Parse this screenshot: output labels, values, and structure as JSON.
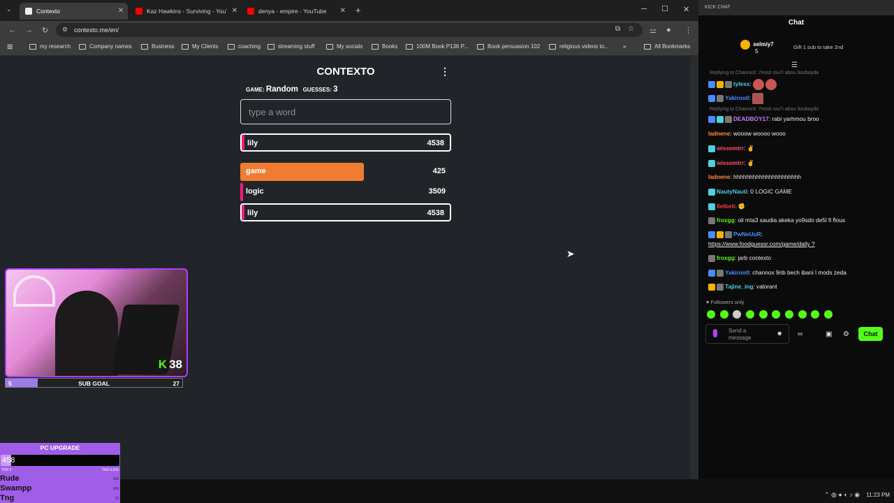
{
  "browser": {
    "tabs": [
      {
        "title": "Contexto",
        "color": "#3c3c3c"
      },
      {
        "title": "Kaz Hawkins - Surviving - YouTube",
        "color": "#ff0000"
      },
      {
        "title": "denya - empire - YouTube",
        "color": "#ff0000"
      }
    ],
    "url": "contexto.me/en/",
    "bookmarks": [
      "my research",
      "Company names",
      "Business",
      "My Clients",
      "coaching",
      "streaming stuff",
      "My socials",
      "Books",
      "100M Book P136 P...",
      "Book persuasion 102",
      "religious videos to...",
      "All Bookmarks"
    ]
  },
  "game": {
    "title": "CONTEXTO",
    "game_label": "GAME:",
    "game_value": "Random",
    "guesses_label": "GUESSES:",
    "guesses_value": "3",
    "input_placeholder": "type a word",
    "last_guess": {
      "word": "lily",
      "rank": "4538"
    },
    "guesses": [
      {
        "word": "game",
        "rank": "425",
        "bar_fraction": 0.59,
        "color": "#ef7d31"
      },
      {
        "word": "logic",
        "rank": "3509",
        "bar_fraction": 0.012,
        "color": "#f01d7a"
      },
      {
        "word": "lily",
        "rank": "4538",
        "bar_fraction": 0.01,
        "color": "#f01d7a"
      }
    ]
  },
  "overlay": {
    "kick_count": "38",
    "subgoal": {
      "current": "5",
      "label": "SUB GOAL",
      "target": "27",
      "progress": 0.18
    },
    "pc_upgrade": {
      "title": "PC UPGRADE",
      "value": "458",
      "min": "TND 0",
      "max": "TND 5,000",
      "progress": 0.09,
      "donors": [
        {
          "name": "Rude",
          "amount": "120"
        },
        {
          "name": "Swampp",
          "amount": "100"
        },
        {
          "name": "Tng",
          "amount": "70"
        }
      ]
    }
  },
  "chat": {
    "header": "KICK CHAT",
    "title": "Chat",
    "top_gifter": {
      "name": "selmiy7",
      "count": "5"
    },
    "gift_prompt": "Gift 1 sub to take 2nd",
    "messages": [
      {
        "type": "reply",
        "text": "Replying to ChannoX: 7essit rou7i abou 3oubayda"
      },
      {
        "user": "tylexx",
        "color": "#4dd0e1",
        "text": ""
      },
      {
        "user": "Yakiroo0",
        "color": "#4a8cff",
        "text": ""
      },
      {
        "type": "reply",
        "text": "Replying to ChannoX: 7essit rou7i abou 3oubayda"
      },
      {
        "user": "DEADBOY17",
        "color": "#c77dff",
        "text": "rabi yarhmou broo"
      },
      {
        "user": "ladnene",
        "color": "#ff8a3d",
        "text": "wooow woooo wooo"
      },
      {
        "user": "wissemtrr",
        "color": "#ff4d6d",
        "text": ""
      },
      {
        "user": "wissemtrr",
        "color": "#ff4d6d",
        "text": ""
      },
      {
        "user": "ladnene",
        "color": "#ff8a3d",
        "text": "hhhhhhhhhhhhhhhhhhhhh"
      },
      {
        "user": "NautyNauti",
        "color": "#4dd0e1",
        "text": "0 LOGIC GAME"
      },
      {
        "user": "lletbeli",
        "color": "#ff3b3b",
        "text": ""
      },
      {
        "user": "froxgg",
        "color": "#53fc18",
        "text": "oil mta3 saudia akeka yo9sdo de5l fi flous"
      },
      {
        "user": "PwNeUuR",
        "color": "#4a8cff",
        "text": ""
      },
      {
        "type": "link",
        "text": "https://www.foodguessr.com/game/daily ?"
      },
      {
        "user": "froxgg",
        "color": "#53fc18",
        "text": "jarb contexto"
      },
      {
        "user": "Yakiroo0",
        "color": "#4a8cff",
        "text": "channox 9rib bech ibani l mods zeda"
      },
      {
        "user": "Tajine_ing",
        "color": "#4dd0e1",
        "text": "valorant"
      }
    ],
    "followers_only": "Followers only",
    "input_placeholder": "Send a message",
    "send_label": "Chat"
  },
  "taskbar": {
    "time": "11:23 PM"
  }
}
